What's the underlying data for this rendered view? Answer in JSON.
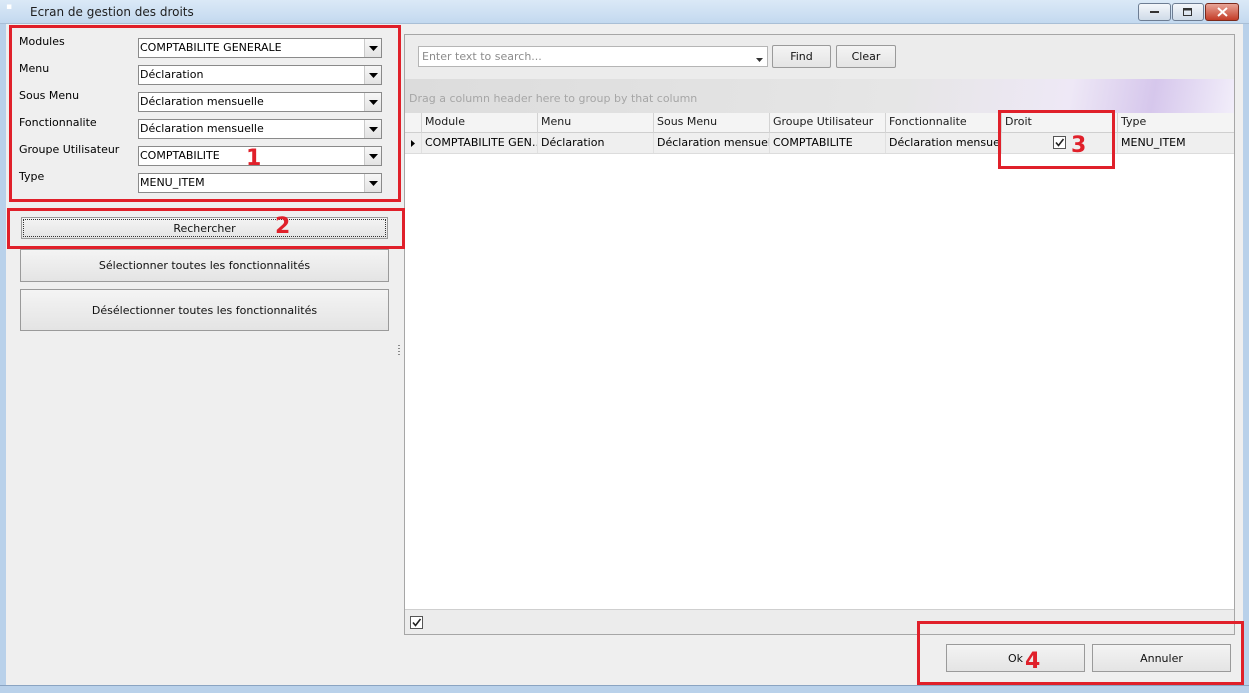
{
  "window": {
    "title": "Ecran de gestion des droits"
  },
  "filters": [
    {
      "label": "Modules",
      "value": "COMPTABILITE GENERALE"
    },
    {
      "label": "Menu",
      "value": "Déclaration"
    },
    {
      "label": "Sous Menu",
      "value": "Déclaration mensuelle"
    },
    {
      "label": "Fonctionnalite",
      "value": "Déclaration mensuelle"
    },
    {
      "label": "Groupe Utilisateur",
      "value": "COMPTABILITE"
    },
    {
      "label": "Type",
      "value": "MENU_ITEM"
    }
  ],
  "buttons": {
    "search": "Rechercher",
    "select_all": "Sélectionner toutes les fonctionnalités",
    "deselect_all": "Désélectionner toutes les fonctionnalités",
    "ok": "Ok",
    "cancel": "Annuler"
  },
  "findpanel": {
    "placeholder": "Enter text to search...",
    "find": "Find",
    "clear": "Clear"
  },
  "grid": {
    "group_hint": "Drag a column header here to group by that column",
    "columns": [
      "Module",
      "Menu",
      "Sous Menu",
      "Groupe Utilisateur",
      "Fonctionnalite",
      "Droit",
      "Type"
    ],
    "rows": [
      {
        "module": "COMPTABILITE GEN…",
        "menu": "Déclaration",
        "sous_menu": "Déclaration mensuelle",
        "groupe": "COMPTABILITE",
        "fonctionnalite": "Déclaration mensuelle",
        "droit": true,
        "type": "MENU_ITEM"
      }
    ],
    "footer_checked": true
  },
  "annotations": [
    "1",
    "2",
    "3",
    "4"
  ],
  "colors": {
    "annotation": "#e0202a",
    "window_frame": "#b9d1ea",
    "client_bg": "#efefef"
  }
}
